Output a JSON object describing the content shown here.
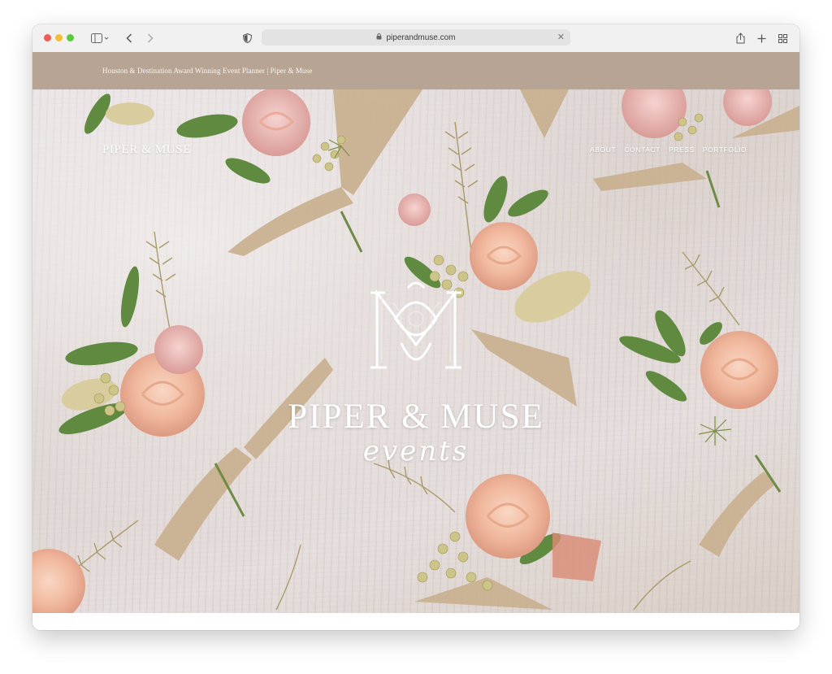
{
  "browser": {
    "url": "piperandmuse.com",
    "icons": {
      "sidebar": "sidebar-icon",
      "back": "chevron-left-icon",
      "forward": "chevron-right-icon",
      "privacy": "shield-icon",
      "lock": "lock-icon",
      "clear": "close-icon",
      "share": "share-icon",
      "new_tab": "plus-icon",
      "tabs": "grid-icon"
    }
  },
  "topbar": {
    "tagline": "Houston & Destination Award Winning Event Planner | Piper & Muse",
    "color": "#b7a494"
  },
  "header": {
    "logo": "PIPER & MUSE",
    "nav": [
      "ABOUT",
      "CONTACT",
      "PRESS",
      "PORTFOLIO"
    ]
  },
  "hero": {
    "brand": "PIPER & MUSE",
    "brand_sub": "events",
    "monogram": "monogram-icon"
  }
}
